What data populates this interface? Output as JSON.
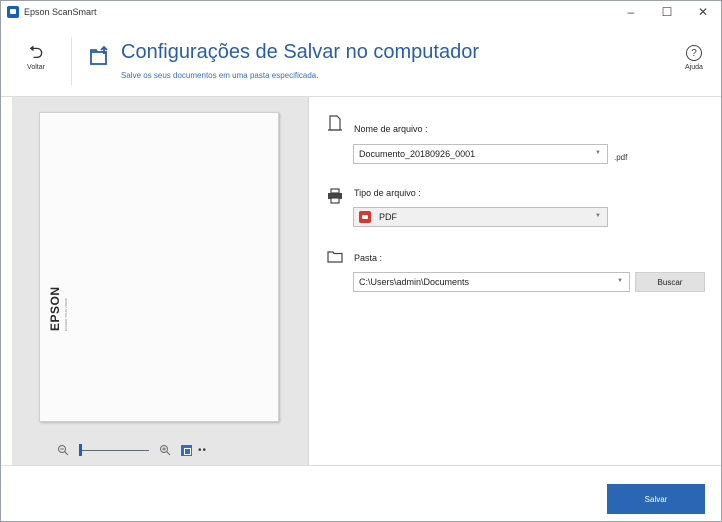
{
  "window": {
    "title": "Epson ScanSmart",
    "controls": {
      "minimize": "–",
      "maximize": "☐",
      "close": "✕"
    }
  },
  "header": {
    "back_label": "Voltar",
    "title": "Configurações de Salvar no computador",
    "subtitle": "Salve os seus documentos em uma pasta especificada.",
    "help_label": "Ajuda"
  },
  "preview": {
    "page_logo": "EPSON",
    "page_logo_sub": "EXCEED YOUR VISION",
    "zoom_level": 0.0
  },
  "settings": {
    "filename_label": "Nome de arquivo :",
    "filename_value": "Documento_20180926_0001",
    "filename_ext": ".pdf",
    "filetype_label": "Tipo de arquivo :",
    "filetype_value": "PDF",
    "folder_label": "Pasta :",
    "folder_value": "C:\\Users\\admin\\Documents",
    "browse_label": "Buscar"
  },
  "footer": {
    "save_label": "Salvar"
  },
  "colors": {
    "accent": "#2a66b3",
    "title_blue": "#2a5ea8",
    "pdf_red": "#d9382f"
  }
}
